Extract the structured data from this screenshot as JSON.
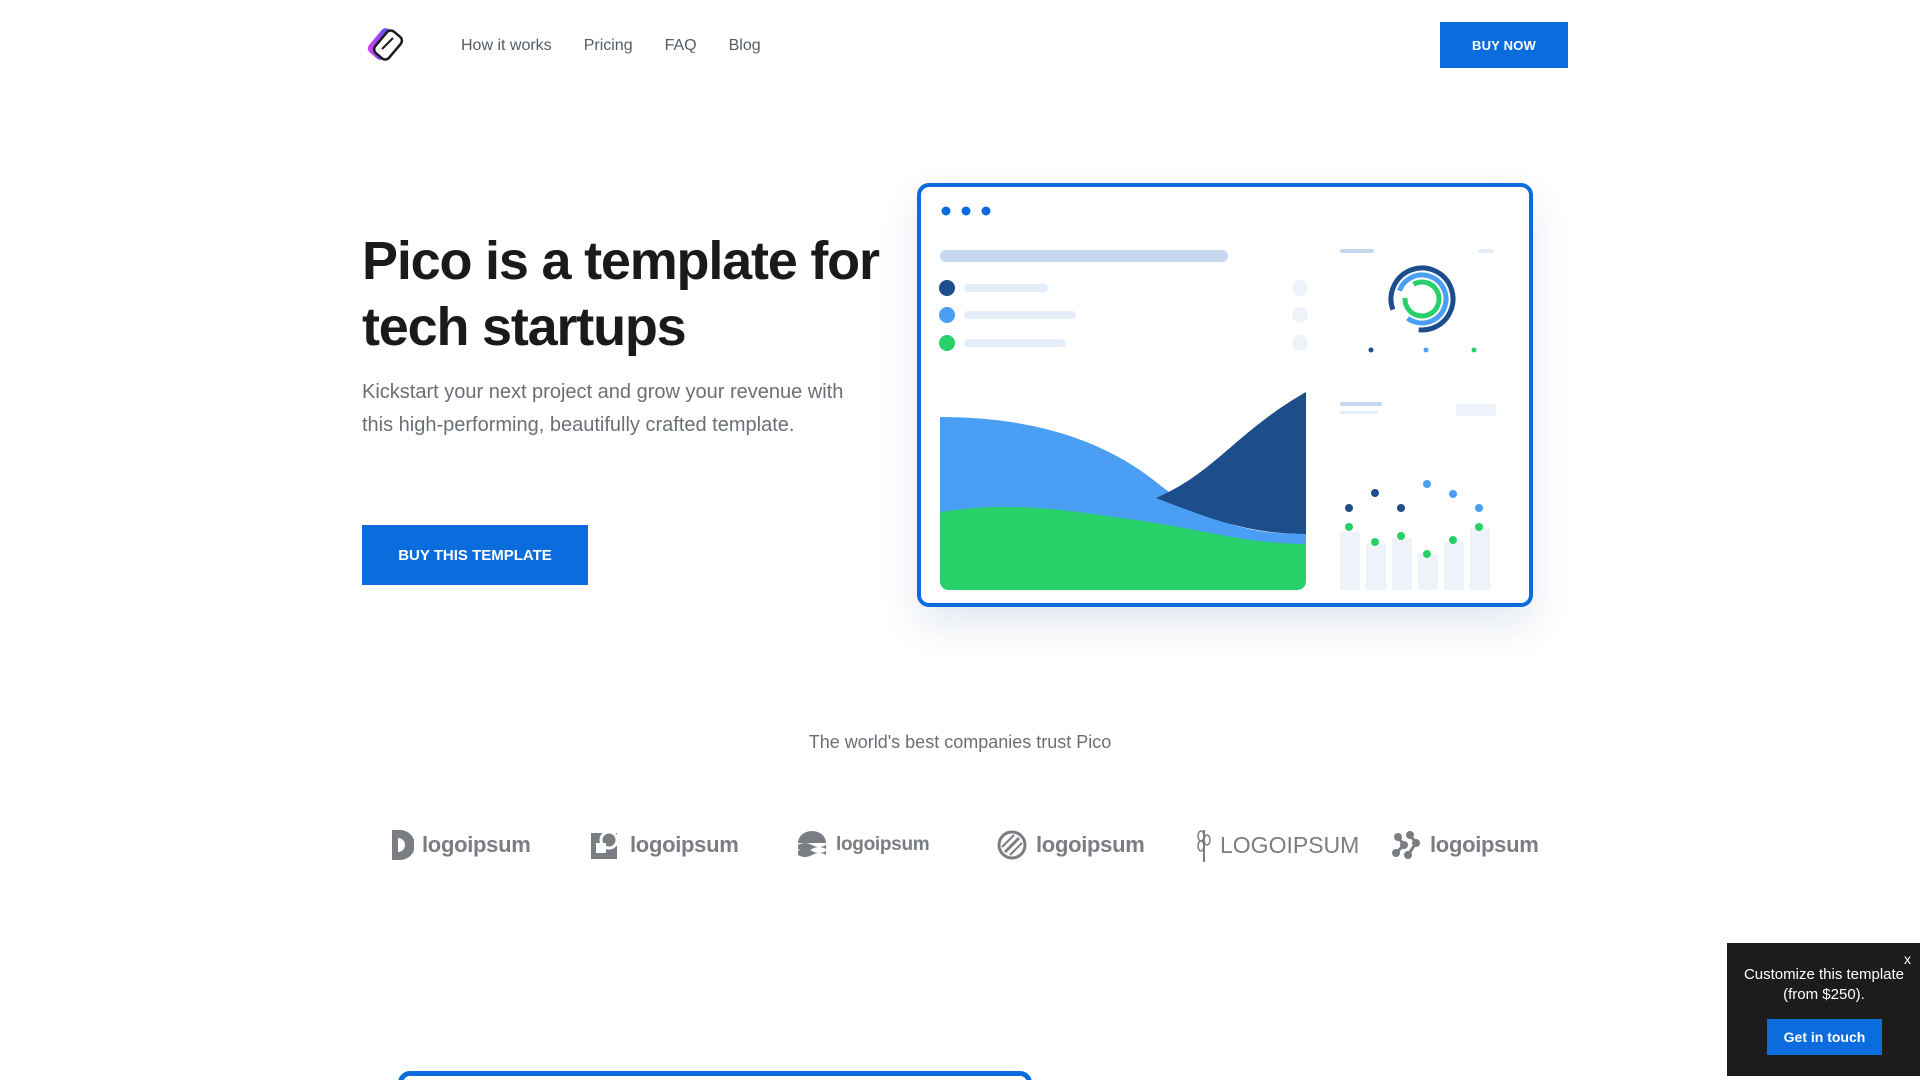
{
  "header": {
    "nav": [
      "How it works",
      "Pricing",
      "FAQ",
      "Blog"
    ],
    "buy_now": "BUY NOW"
  },
  "hero": {
    "title": "Pico is a template for tech startups",
    "subtitle": "Kickstart your next project and grow your revenue with this high-performing, beautifully crafted template.",
    "cta": "BUY THIS TEMPLATE"
  },
  "trust": {
    "title": "The world's best companies trust Pico",
    "logos": [
      "logoipsum",
      "logoipsum",
      "logoipsum",
      "logoipsum",
      "LOGOIPSUM",
      "logoipsum"
    ]
  },
  "popup": {
    "close": "x",
    "text": "Customize this template (from $250).",
    "button": "Get in touch"
  },
  "colors": {
    "accent": "#0a6cdd",
    "dark_blue": "#1d4d8a",
    "light_blue": "#4a9ff5",
    "green": "#28d06a"
  }
}
